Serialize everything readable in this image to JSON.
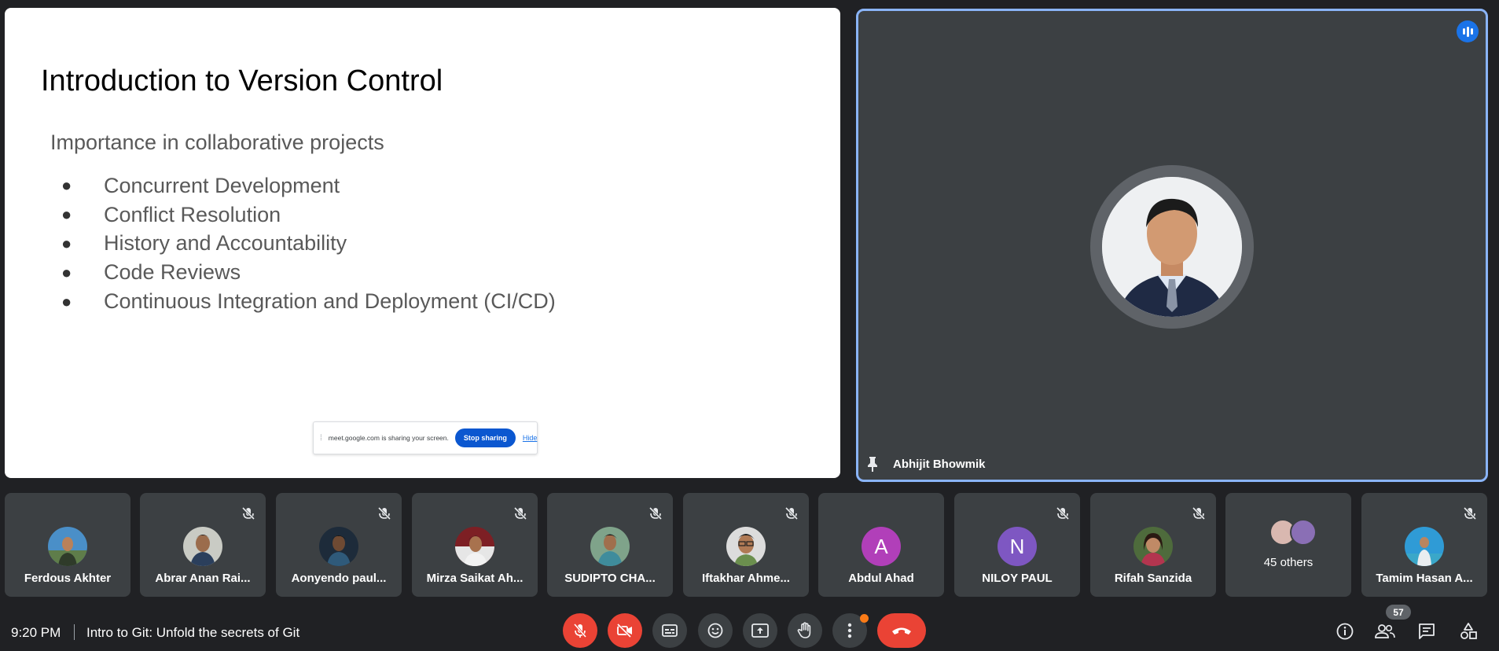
{
  "slide": {
    "title": "Introduction to Version Control",
    "subtitle": "Importance in collaborative projects",
    "bullets": [
      "Concurrent Development",
      "Conflict Resolution",
      "History and Accountability",
      "Code Reviews",
      "Continuous Integration and Deployment (CI/CD)"
    ],
    "bullet_glyph": "●"
  },
  "share_bar": {
    "text": "meet.google.com is sharing your screen.",
    "stop_label": "Stop sharing",
    "hide_label": "Hide"
  },
  "speaker": {
    "name": "Abhijit Bhowmik",
    "pinned": true,
    "speaking": true
  },
  "participants": [
    {
      "name": "Ferdous Akhter",
      "muted": false,
      "avatar": "photo"
    },
    {
      "name": "Abrar Anan Rai...",
      "muted": true,
      "avatar": "photo"
    },
    {
      "name": "Aonyendo paul...",
      "muted": true,
      "avatar": "photo"
    },
    {
      "name": "Mirza Saikat Ah...",
      "muted": true,
      "avatar": "photo"
    },
    {
      "name": "SUDIPTO CHA...",
      "muted": true,
      "avatar": "photo"
    },
    {
      "name": "Iftakhar Ahme...",
      "muted": true,
      "avatar": "photo"
    },
    {
      "name": "Abdul Ahad",
      "muted": false,
      "avatar": "letter",
      "letter": "A",
      "color": "#b13fb9"
    },
    {
      "name": "NILOY PAUL",
      "muted": true,
      "avatar": "letter",
      "letter": "N",
      "color": "#7e57c2"
    },
    {
      "name": "Rifah Sanzida",
      "muted": true,
      "avatar": "photo"
    },
    {
      "name": "Tamim Hasan A...",
      "muted": true,
      "avatar": "photo"
    }
  ],
  "others": {
    "label": "45 others"
  },
  "bottom_bar": {
    "time": "9:20 PM",
    "meeting_title": "Intro to Git: Unfold the secrets of Git",
    "people_count": "57"
  },
  "colors": {
    "background": "#202124",
    "tile": "#3c4043",
    "accent_blue": "#8ab4f8",
    "danger_red": "#ea4335"
  }
}
